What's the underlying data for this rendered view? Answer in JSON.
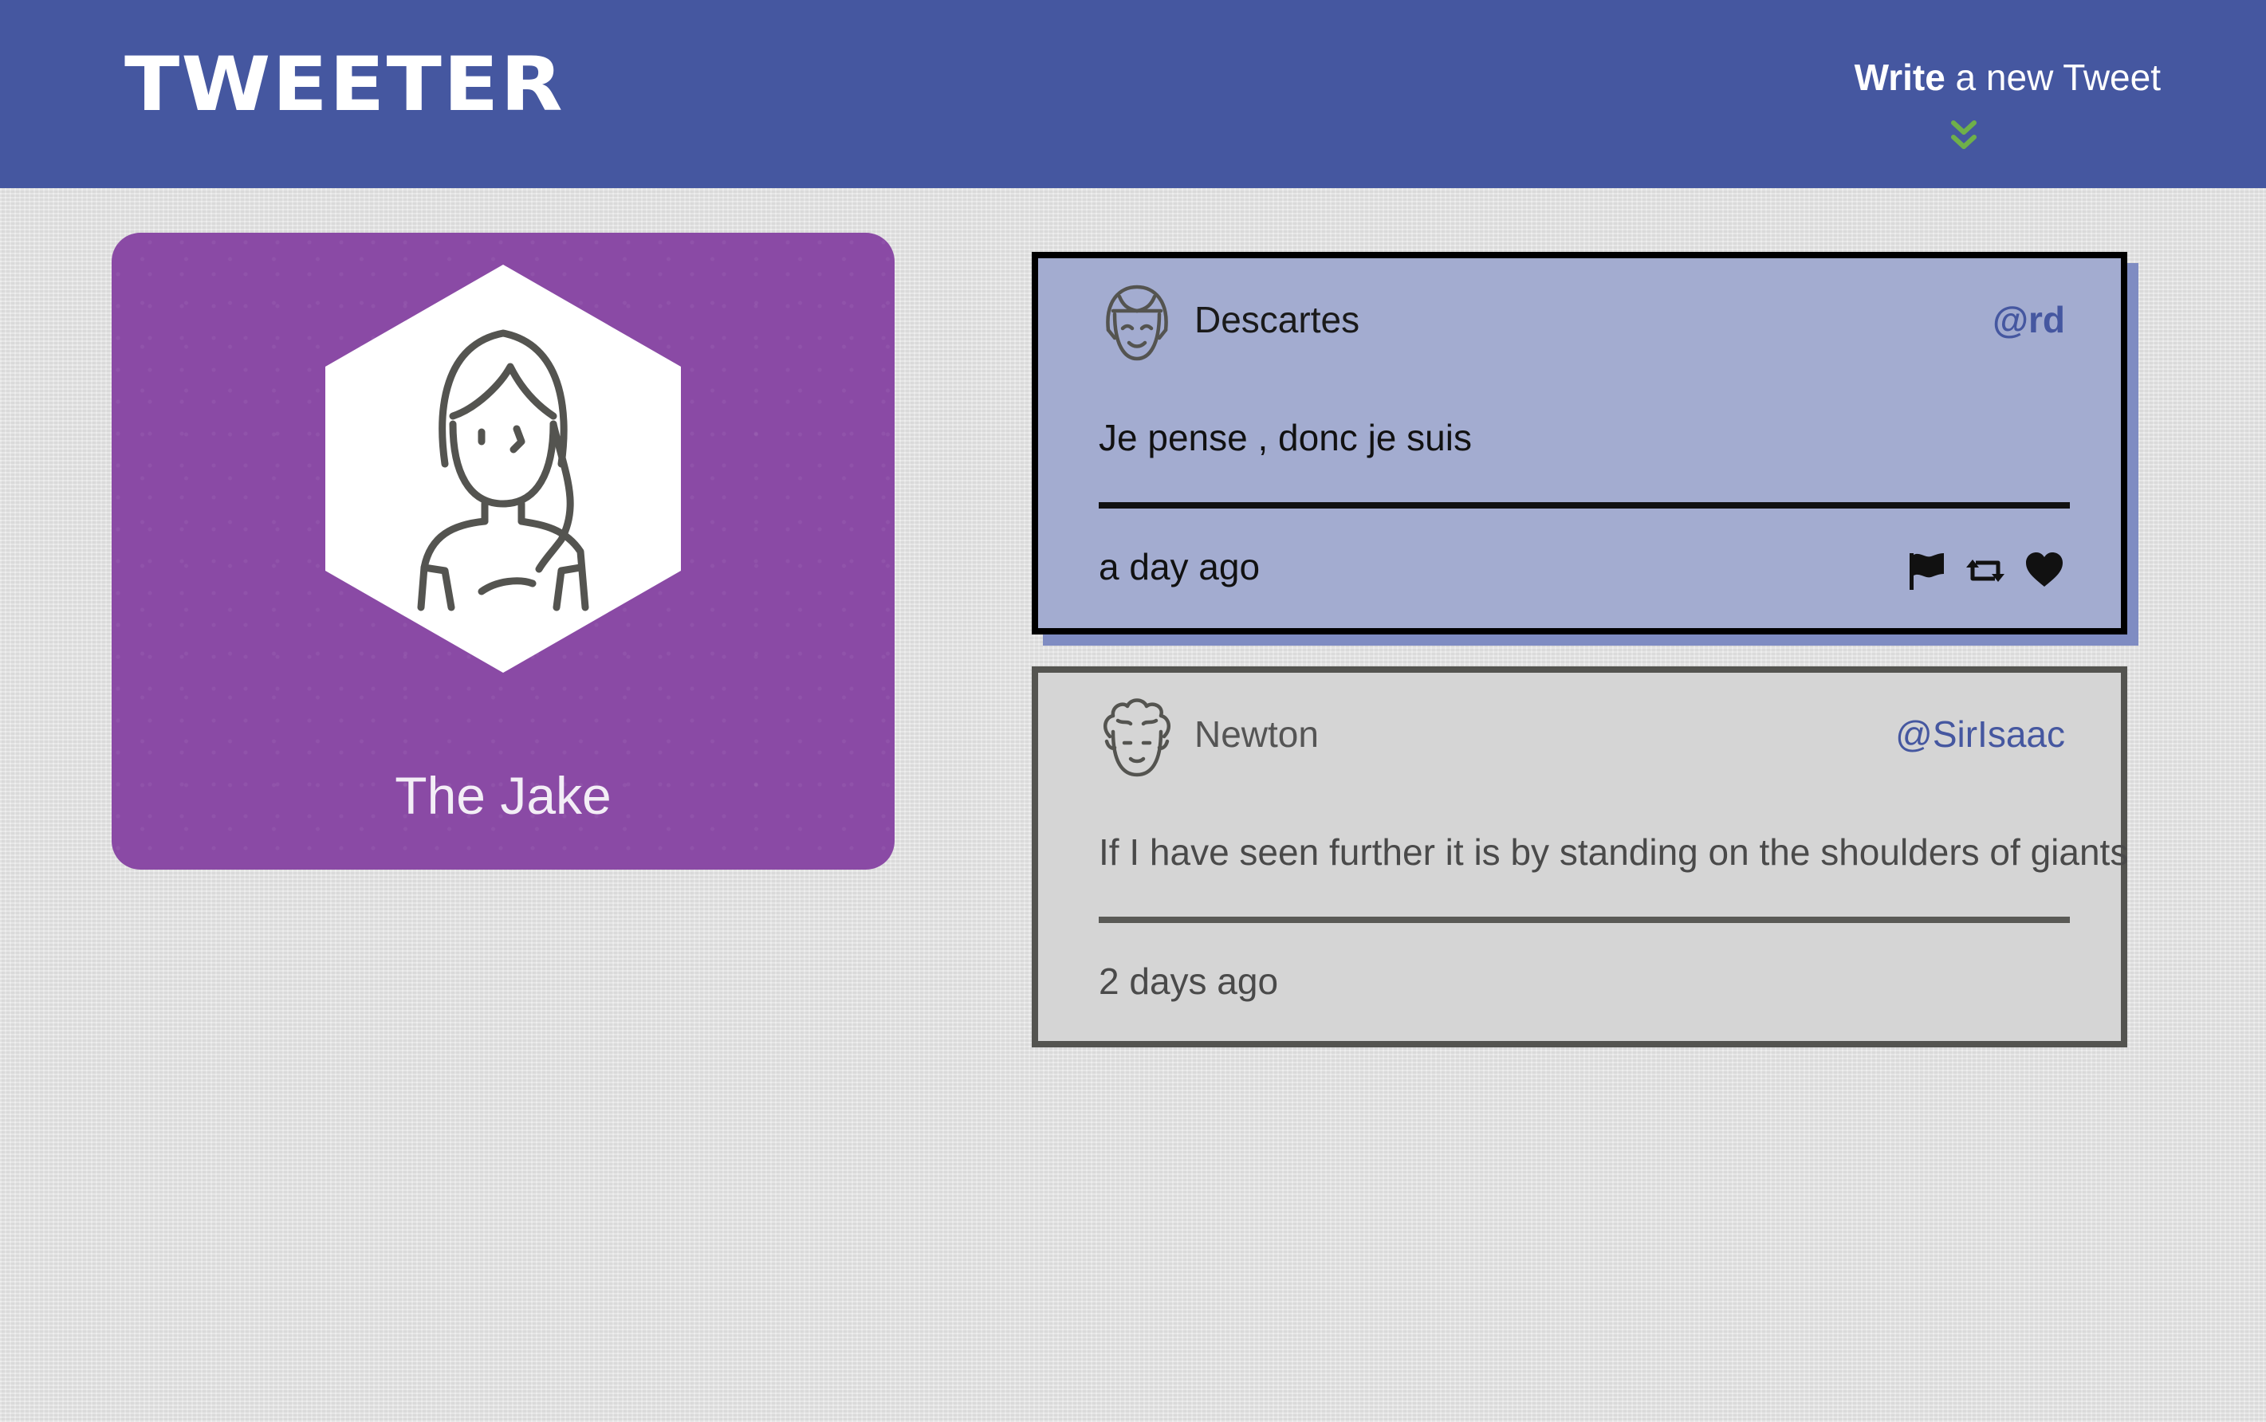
{
  "header": {
    "logo": "TWEETER",
    "compose_bold": "Write",
    "compose_rest": " a new Tweet",
    "compose_icon": "double-chevron-down-icon",
    "background_color": "#4557a0",
    "chevron_color": "#6fb04a"
  },
  "profile": {
    "name": "The Jake",
    "background_color": "#8a4aa5",
    "avatar_icon": "user-avatar-icon"
  },
  "tweets": [
    {
      "author": "Descartes",
      "handle": "@rd",
      "content": "Je pense , donc je suis",
      "timestamp": "a day ago",
      "avatar_icon": "descartes-avatar-icon",
      "actions": [
        "flag-icon",
        "retweet-icon",
        "heart-icon"
      ],
      "state": "hovered"
    },
    {
      "author": "Newton",
      "handle": "@SirIsaac",
      "content": "If I have seen further it is by standing on the shoulders of giants",
      "timestamp": "2 days ago",
      "avatar_icon": "newton-avatar-icon",
      "state": "default"
    }
  ]
}
